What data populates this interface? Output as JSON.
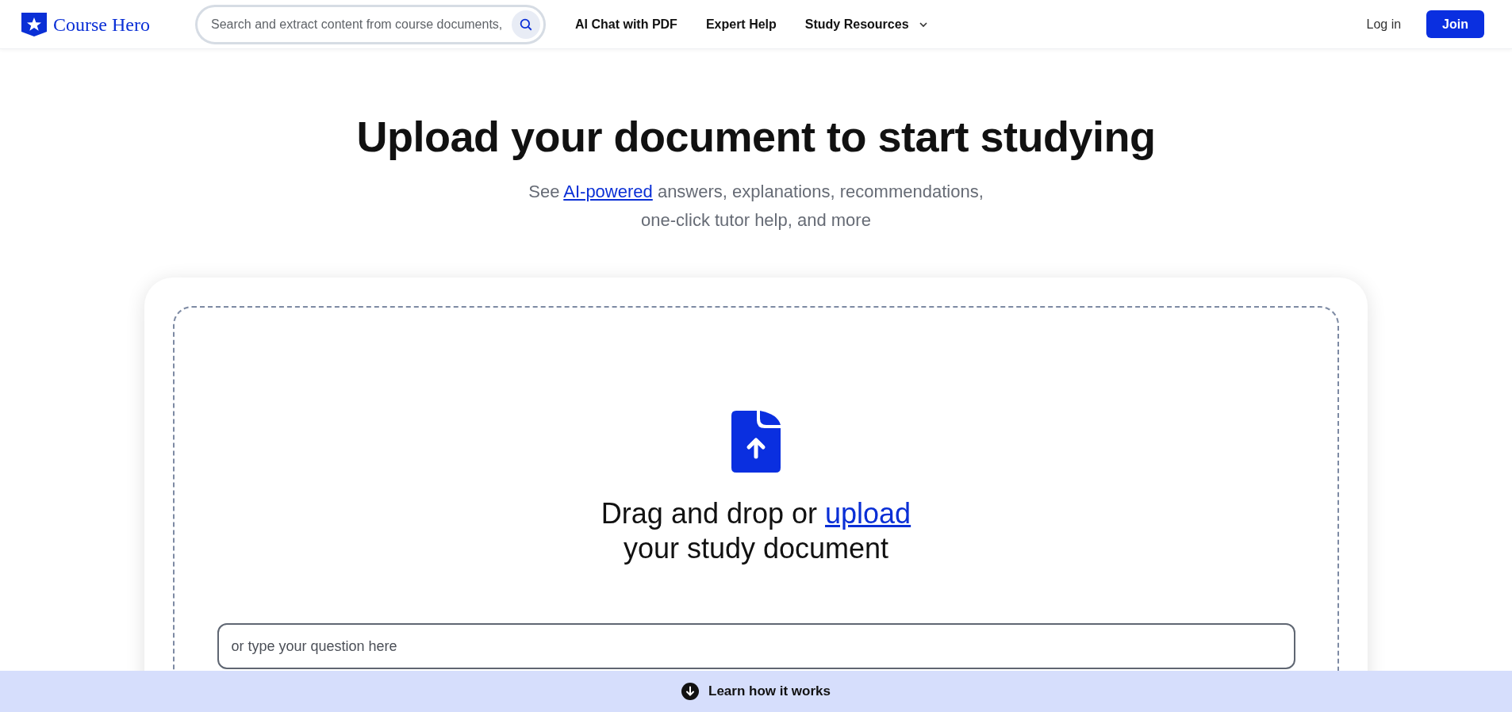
{
  "header": {
    "logo": "Course Hero",
    "search": {
      "placeholder": "Search and extract content from course documents, "
    },
    "nav": [
      {
        "label": "AI Chat with PDF",
        "has_menu": false
      },
      {
        "label": "Expert Help",
        "has_menu": false
      },
      {
        "label": "Study Resources",
        "has_menu": true
      }
    ],
    "login": "Log in",
    "join": "Join"
  },
  "hero": {
    "title": "Upload your document to start studying",
    "subtitle": {
      "before": "See ",
      "link": "AI-powered",
      "after": " answers, explanations, recommendations, one-click tutor help, and more"
    }
  },
  "upload": {
    "before": "Drag and drop or ",
    "link": "upload",
    "after": " your study document",
    "question": {
      "placeholder": "or type your question here"
    }
  },
  "footer_bar": {
    "label": "Learn how it works"
  }
}
